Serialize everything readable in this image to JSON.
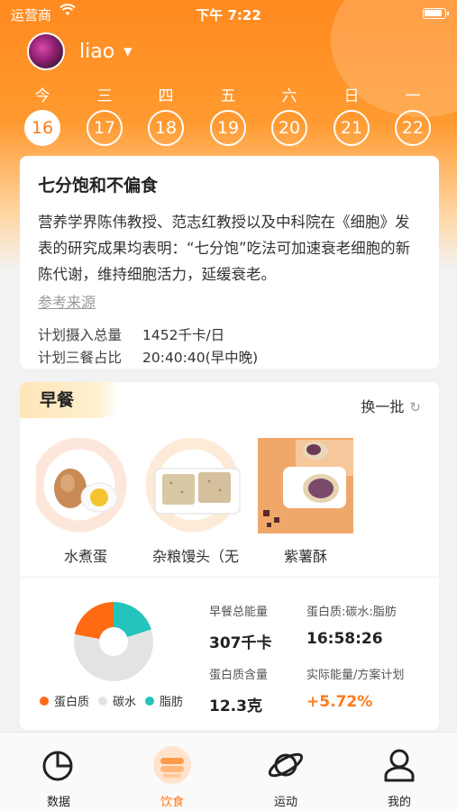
{
  "status": {
    "carrier": "运营商",
    "time": "下午 7:22"
  },
  "user": {
    "name": "liao"
  },
  "week": [
    {
      "wd": "今",
      "day": "16",
      "active": true
    },
    {
      "wd": "三",
      "day": "17"
    },
    {
      "wd": "四",
      "day": "18"
    },
    {
      "wd": "五",
      "day": "19"
    },
    {
      "wd": "六",
      "day": "20"
    },
    {
      "wd": "日",
      "day": "21"
    },
    {
      "wd": "一",
      "day": "22"
    }
  ],
  "intro": {
    "title": "七分饱和不偏食",
    "body": "营养学界陈伟教授、范志红教授以及中科院在《细胞》发表的研究成果均表明：“七分饱”吃法可加速衰老细胞的新陈代谢，维持细胞活力，延缓衰老。",
    "ref": "参考来源",
    "plan_total_label": "计划摄入总量",
    "plan_total_value": "1452千卡/日",
    "plan_ratio_label": "计划三餐占比",
    "plan_ratio_value": "20:40:40(早中晚)"
  },
  "meal": {
    "title": "早餐",
    "refresh_label": "换一批",
    "foods": [
      {
        "name": "水煮蛋"
      },
      {
        "name": "杂粮馒头（无"
      },
      {
        "name": "紫薯酥"
      }
    ],
    "legend": [
      {
        "name": "蛋白质",
        "color": "#ff6a13"
      },
      {
        "name": "碳水",
        "color": "#e3e3e3"
      },
      {
        "name": "脂肪",
        "color": "#24c4bd"
      }
    ],
    "pie_fractions": {
      "protein": 0.22,
      "carb": 0.58,
      "fat": 0.2
    },
    "stats": {
      "energy_label": "早餐总能量",
      "energy_value": "307千卡",
      "ratio_label": "蛋白质:碳水:脂肪",
      "ratio_value": "16:58:26",
      "protein_label": "蛋白质含量",
      "protein_value": "12.3克",
      "plan_label": "实际能量/方案计划",
      "plan_value": "+5.72%"
    }
  },
  "tabs": [
    {
      "label": "数据",
      "icon": "pie-chart-icon"
    },
    {
      "label": "饮食",
      "icon": "bowl-icon",
      "active": true
    },
    {
      "label": "运动",
      "icon": "planet-icon"
    },
    {
      "label": "我的",
      "icon": "person-icon"
    }
  ]
}
